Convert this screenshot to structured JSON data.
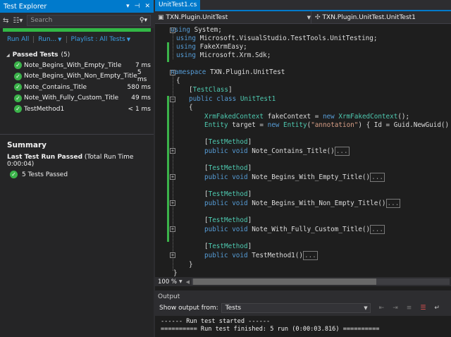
{
  "test_explorer": {
    "title": "Test Explorer",
    "title_controls": [
      "▾",
      "⊣",
      "✕"
    ],
    "search_placeholder": "Search",
    "toolbar": {
      "run_all": "Run All",
      "run": "Run...",
      "playlist": "Playlist : All Tests"
    },
    "group": {
      "label": "Passed Tests",
      "count": "(5)"
    },
    "tests": [
      {
        "name": "Note_Begins_With_Empty_Title",
        "duration": "7 ms"
      },
      {
        "name": "Note_Begins_With_Non_Empty_Title",
        "duration": "5 ms"
      },
      {
        "name": "Note_Contains_Title",
        "duration": "580 ms"
      },
      {
        "name": "Note_With_Fully_Custom_Title",
        "duration": "49 ms"
      },
      {
        "name": "TestMethod1",
        "duration": "< 1 ms"
      }
    ],
    "summary": {
      "heading": "Summary",
      "last_run": "Last Test Run Passed",
      "total_time": "(Total Run Time 0:00:04)",
      "passed": "5 Tests Passed"
    }
  },
  "editor": {
    "tab": "UnitTest1.cs",
    "nav_left": "TXN.Plugin.UnitTest",
    "nav_right": "TXN.Plugin.UnitTest.UnitTest1",
    "zoom": "100 %",
    "code": {
      "l1": "using System;",
      "l2": "using Microsoft.VisualStudio.TestTools.UnitTesting;",
      "l3": "using FakeXrmEasy;",
      "l4": "using Microsoft.Xrm.Sdk;",
      "ns": "TXN.Plugin.UnitTest",
      "class_attr": "TestClass",
      "class_name": "UnitTest1",
      "ctx_type": "XrmFakedContext",
      "ctx_var": "fakeContext",
      "entity_type": "Entity",
      "entity_var": "target",
      "entity_name": "\"annotation\"",
      "entity_tail": ") { Id = Guid.NewGuid() };",
      "method_attr": "TestMethod",
      "methods": [
        "Note_Contains_Title()",
        "Note_Begins_With_Empty_Title()",
        "Note_Begins_With_Non_Empty_Title()",
        "Note_With_Fully_Custom_Title()",
        "TestMethod1()"
      ],
      "collapsed": "..."
    }
  },
  "output": {
    "title": "Output",
    "show_from_label": "Show output from:",
    "source": "Tests",
    "lines": [
      "------ Run test started ------",
      "========== Run test finished: 5 run (0:00:03.816) =========="
    ]
  },
  "colors": {
    "accent": "#007acc",
    "pass": "#3bb34a",
    "keyword": "#569cd6",
    "type": "#4ec9b0",
    "string": "#d69d85"
  }
}
